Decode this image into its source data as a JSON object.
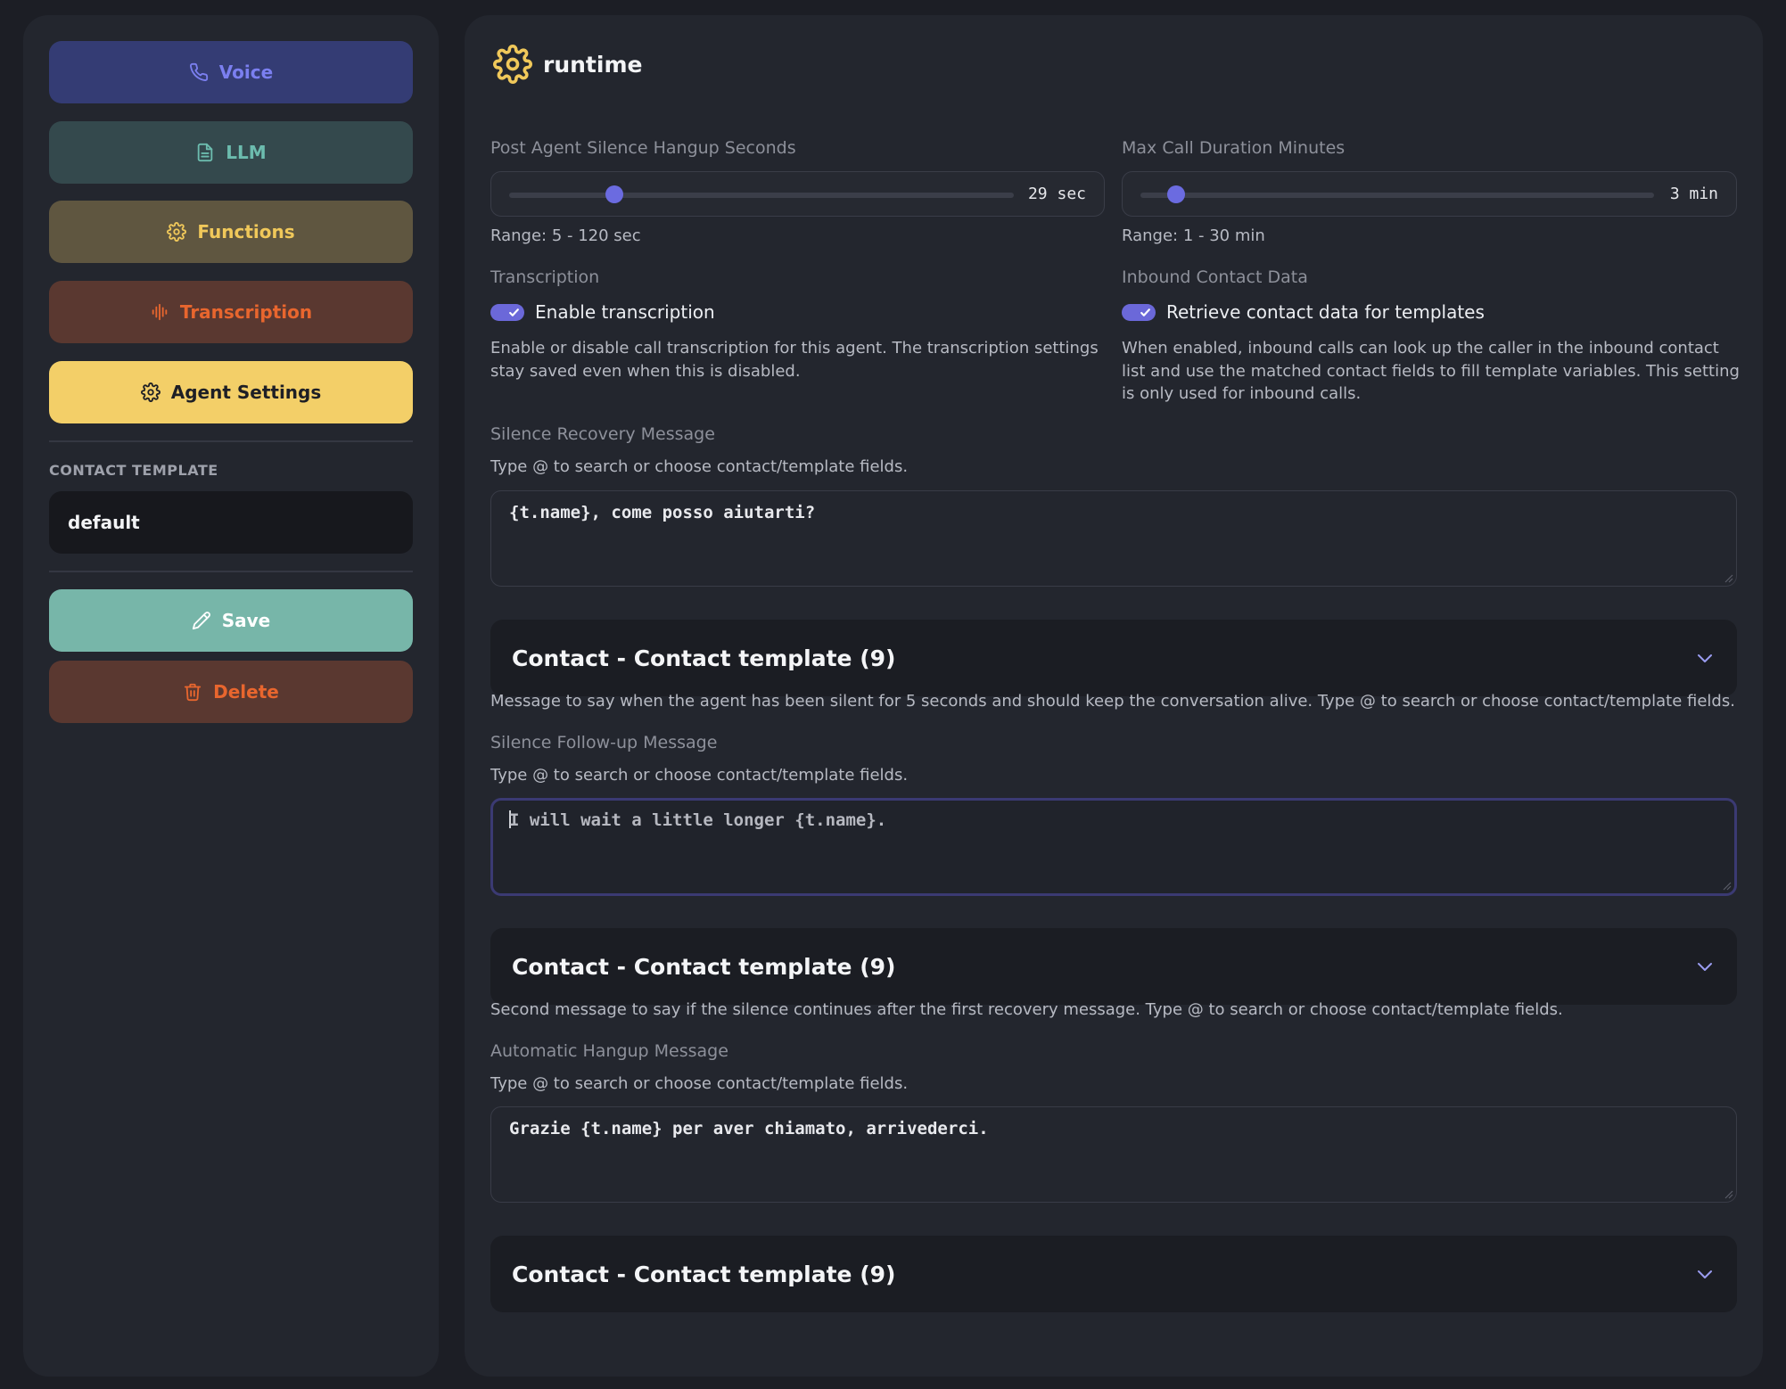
{
  "sidebar": {
    "voice_label": "Voice",
    "llm_label": "LLM",
    "functions_label": "Functions",
    "transcription_label": "Transcription",
    "agent_settings_label": "Agent Settings",
    "contact_template_heading": "CONTACT TEMPLATE",
    "contact_template_value": "default",
    "save_label": "Save",
    "delete_label": "Delete"
  },
  "main": {
    "title": "runtime",
    "post_silence": {
      "label": "Post Agent Silence Hangup Seconds",
      "value_text": "29 sec",
      "value": 29,
      "min": 5,
      "max": 120,
      "range_text": "Range: 5 - 120 sec"
    },
    "max_duration": {
      "label": "Max Call Duration Minutes",
      "value_text": "3 min",
      "value": 3,
      "min": 1,
      "max": 30,
      "range_text": "Range: 1 - 30 min"
    },
    "transcription": {
      "label": "Transcription",
      "toggle_label": "Enable transcription",
      "enabled": true,
      "description": "Enable or disable call transcription for this agent. The transcription settings stay saved even when this is disabled."
    },
    "inbound": {
      "label": "Inbound Contact Data",
      "toggle_label": "Retrieve contact data for templates",
      "enabled": true,
      "description": "When enabled, inbound calls can look up the caller in the inbound contact list and use the matched contact fields to fill template variables. This setting is only used for inbound calls."
    },
    "silence_recovery": {
      "label": "Silence Recovery Message",
      "hint": "Type @ to search or choose contact/template fields.",
      "value": "{t.name}, come posso aiutarti?",
      "accordion": "Contact - Contact template (9)",
      "description": "Message to say when the agent has been silent for 5 seconds and should keep the conversation alive. Type @ to search or choose contact/template fields."
    },
    "silence_followup": {
      "label": "Silence Follow-up Message",
      "hint": "Type @ to search or choose contact/template fields.",
      "value": "I will wait a little longer {t.name}.",
      "accordion": "Contact - Contact template (9)",
      "description": "Second message to say if the silence continues after the first recovery message. Type @ to search or choose contact/template fields."
    },
    "auto_hangup": {
      "label": "Automatic Hangup Message",
      "hint": "Type @ to search or choose contact/template fields.",
      "value": "Grazie {t.name} per aver chiamato, arrivederci.",
      "accordion": "Contact - Contact template (9)"
    }
  },
  "colors": {
    "accent": "#6b68d9",
    "agent_settings_bg": "#f3cf68",
    "save_bg": "#77b6a9",
    "delete_text": "#e8662e"
  }
}
